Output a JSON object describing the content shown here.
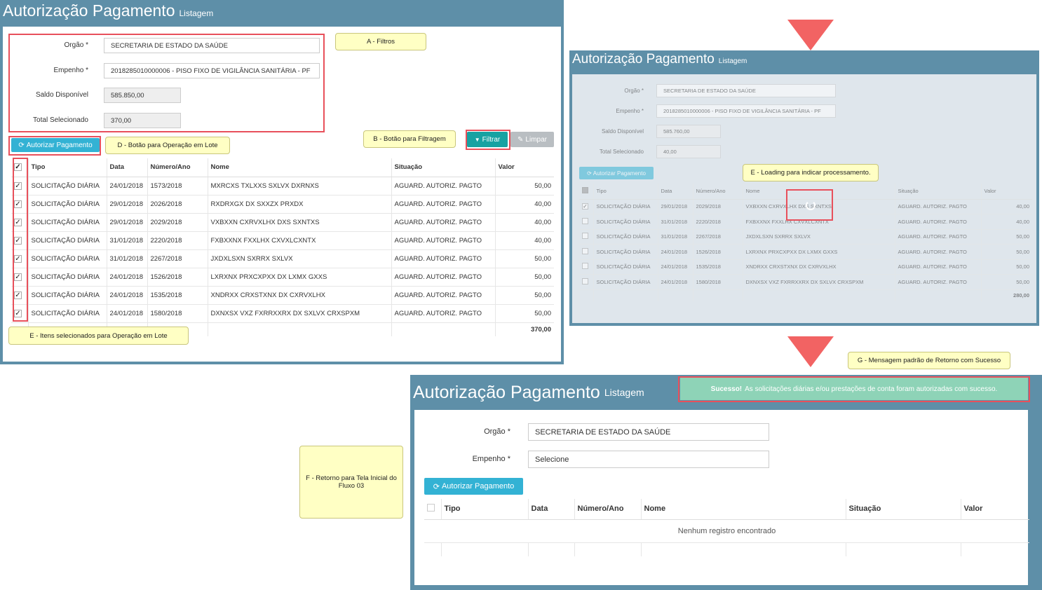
{
  "header": {
    "title": "Autorização Pagamento",
    "subtitle": "Listagem"
  },
  "form": {
    "orgao_label": "Orgão *",
    "orgao_value": "SECRETARIA DE ESTADO DA SAÚDE",
    "empenho_label": "Empenho *",
    "empenho_value": "2018285010000006 - PISO FIXO DE VIGILÂNCIA SANITÁRIA - PF",
    "saldo_label": "Saldo Disponível",
    "saldo_value": "585.850,00",
    "total_label": "Total Selecionado",
    "total_value": "370,00"
  },
  "buttons": {
    "autorizar": "Autorizar Pagamento",
    "filtrar": "Filtrar",
    "limpar": "Limpar"
  },
  "table": {
    "columns": [
      "Tipo",
      "Data",
      "Número/Ano",
      "Nome",
      "Situação",
      "Valor"
    ],
    "rows": [
      [
        "SOLICITAÇÃO DIÁRIA",
        "24/01/2018",
        "1573/2018",
        "MXRCXS TXLXXS SXLVX DXRNXS",
        "AGUARD. AUTORIZ. PAGTO",
        "50,00"
      ],
      [
        "SOLICITAÇÃO DIÁRIA",
        "29/01/2018",
        "2026/2018",
        "RXDRXGX DX SXXZX PRXDX",
        "AGUARD. AUTORIZ. PAGTO",
        "40,00"
      ],
      [
        "SOLICITAÇÃO DIÁRIA",
        "29/01/2018",
        "2029/2018",
        "VXBXXN CXRVXLHX DXS SXNTXS",
        "AGUARD. AUTORIZ. PAGTO",
        "40,00"
      ],
      [
        "SOLICITAÇÃO DIÁRIA",
        "31/01/2018",
        "2220/2018",
        "FXBXXNX FXXLHX CXVXLCXNTX",
        "AGUARD. AUTORIZ. PAGTO",
        "40,00"
      ],
      [
        "SOLICITAÇÃO DIÁRIA",
        "31/01/2018",
        "2267/2018",
        "JXDXLSXN SXRRX SXLVX",
        "AGUARD. AUTORIZ. PAGTO",
        "50,00"
      ],
      [
        "SOLICITAÇÃO DIÁRIA",
        "24/01/2018",
        "1526/2018",
        "LXRXNX PRXCXPXX DX LXMX GXXS",
        "AGUARD. AUTORIZ. PAGTO",
        "50,00"
      ],
      [
        "SOLICITAÇÃO DIÁRIA",
        "24/01/2018",
        "1535/2018",
        "XNDRXX CRXSTXNX DX CXRVXLHX",
        "AGUARD. AUTORIZ. PAGTO",
        "50,00"
      ],
      [
        "SOLICITAÇÃO DIÁRIA",
        "24/01/2018",
        "1580/2018",
        "DXNXSX VXZ FXRRXXRX DX SXLVX CRXSPXM",
        "AGUARD. AUTORIZ. PAGTO",
        "50,00"
      ]
    ],
    "total": "370,00"
  },
  "panel2": {
    "orgao_value": "SECRETARIA DE ESTADO DA SAÚDE",
    "empenho_value": "2018285010000006 - PISO FIXO DE VIGILÂNCIA SANITÁRIA - PF",
    "saldo_value": "585.760,00",
    "total_value": "40,00",
    "rows": [
      [
        "SOLICITAÇÃO DIÁRIA",
        "29/01/2018",
        "2029/2018",
        "VXBXXN CXRVXLHX DXS SXNTXS",
        "AGUARD. AUTORIZ. PAGTO",
        "40,00"
      ],
      [
        "SOLICITAÇÃO DIÁRIA",
        "31/01/2018",
        "2220/2018",
        "FXBXXNX FXXLHX CXVXLCXNTX",
        "AGUARD. AUTORIZ. PAGTO",
        "40,00"
      ],
      [
        "SOLICITAÇÃO DIÁRIA",
        "31/01/2018",
        "2267/2018",
        "JXDXLSXN SXRRX SXLVX",
        "AGUARD. AUTORIZ. PAGTO",
        "50,00"
      ],
      [
        "SOLICITAÇÃO DIÁRIA",
        "24/01/2018",
        "1526/2018",
        "LXRXNX PRXCXPXX DX LXMX GXXS",
        "AGUARD. AUTORIZ. PAGTO",
        "50,00"
      ],
      [
        "SOLICITAÇÃO DIÁRIA",
        "24/01/2018",
        "1535/2018",
        "XNDRXX CRXSTXNX DX CXRVXLHX",
        "AGUARD. AUTORIZ. PAGTO",
        "50,00"
      ],
      [
        "SOLICITAÇÃO DIÁRIA",
        "24/01/2018",
        "1580/2018",
        "DXNXSX VXZ FXRRXXRX DX SXLVX CRXSPXM",
        "AGUARD. AUTORIZ. PAGTO",
        "50,00"
      ]
    ],
    "total": "280,00"
  },
  "panel3": {
    "orgao_value": "SECRETARIA DE ESTADO DA SAÚDE",
    "empenho_value": "Selecione",
    "empty_message": "Nenhum registro encontrado",
    "success_strong": "Sucesso!",
    "success_text": "As solicitações diárias e/ou prestações de conta foram autorizadas com sucesso."
  },
  "callouts": {
    "a": "A - Filtros",
    "b": "B - Botão para Filtragem",
    "d": "D - Botão para Operação em Lote",
    "e1": "E - Itens selecionados para Operação em Lote",
    "e2": "E - Loading para indicar processamento.",
    "f": "F - Retorno para Tela Inicial do Fluxo 03",
    "g": "G - Mensagem padrão de Retorno com Sucesso"
  },
  "icons": {
    "checkbox": "checkbox-icon",
    "filter": "filter-icon",
    "eraser": "eraser-icon",
    "refresh": "refresh-icon",
    "spinner": "spinner-icon"
  },
  "colors": {
    "header": "#5e8fa8",
    "info": "#33b2d4",
    "teal": "#17a2a2",
    "callout": "#ffffc4",
    "highlight": "#e8505b",
    "success": "#8ed3b7",
    "arrow": "#f26363"
  }
}
